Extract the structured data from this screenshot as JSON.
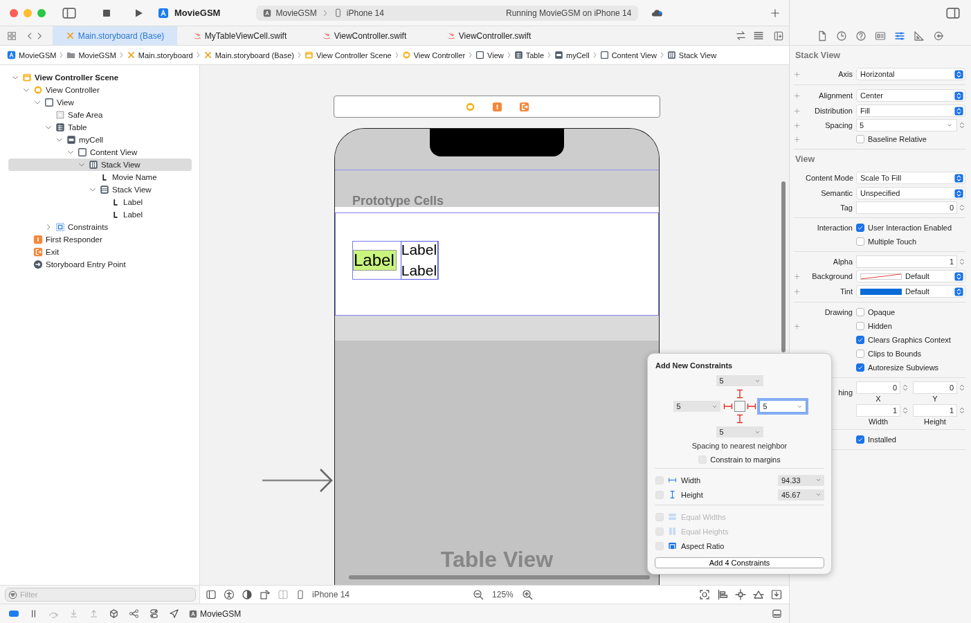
{
  "toolbar": {
    "project": "MovieGSM",
    "scheme": "MovieGSM",
    "device": "iPhone 14",
    "status": "Running MovieGSM on iPhone 14"
  },
  "tabs": [
    {
      "label": "Main.storyboard (Base)",
      "kind": "storyboard",
      "selected": true
    },
    {
      "label": "MyTableViewCell.swift",
      "kind": "swift",
      "selected": false
    },
    {
      "label": "ViewController.swift",
      "kind": "swift",
      "selected": false
    },
    {
      "label": "ViewController.swift",
      "kind": "swift",
      "selected": false
    }
  ],
  "jump_bar": [
    {
      "label": "MovieGSM",
      "kind": "app"
    },
    {
      "label": "MovieGSM",
      "kind": "folder"
    },
    {
      "label": "Main.storyboard",
      "kind": "storyboard"
    },
    {
      "label": "Main.storyboard (Base)",
      "kind": "storyboard"
    },
    {
      "label": "View Controller Scene",
      "kind": "scene"
    },
    {
      "label": "View Controller",
      "kind": "controller"
    },
    {
      "label": "View",
      "kind": "view"
    },
    {
      "label": "Table",
      "kind": "table"
    },
    {
      "label": "myCell",
      "kind": "cell"
    },
    {
      "label": "Content View",
      "kind": "view"
    },
    {
      "label": "Stack View",
      "kind": "hstack"
    }
  ],
  "navigator": {
    "tree": [
      {
        "label": "View Controller Scene",
        "kind": "scene",
        "expanded": true,
        "selected": false,
        "children": [
          {
            "label": "View Controller",
            "kind": "controller",
            "expanded": true,
            "selected": false,
            "children": [
              {
                "label": "View",
                "kind": "view",
                "expanded": true,
                "selected": false,
                "children": [
                  {
                    "label": "Safe Area",
                    "kind": "safearea",
                    "selected": false
                  },
                  {
                    "label": "Table",
                    "kind": "table",
                    "expanded": true,
                    "selected": false,
                    "children": [
                      {
                        "label": "myCell",
                        "kind": "cell",
                        "expanded": true,
                        "selected": false,
                        "children": [
                          {
                            "label": "Content View",
                            "kind": "view",
                            "expanded": true,
                            "selected": false,
                            "children": [
                              {
                                "label": "Stack View",
                                "kind": "hstack",
                                "expanded": true,
                                "selected": true,
                                "children": [
                                  {
                                    "label": "Movie Name",
                                    "kind": "label",
                                    "selected": false
                                  },
                                  {
                                    "label": "Stack View",
                                    "kind": "vstack",
                                    "expanded": true,
                                    "selected": false,
                                    "children": [
                                      {
                                        "label": "Label",
                                        "kind": "label",
                                        "selected": false
                                      },
                                      {
                                        "label": "Label",
                                        "kind": "label",
                                        "selected": false
                                      }
                                    ]
                                  }
                                ]
                              }
                            ]
                          }
                        ]
                      }
                    ]
                  },
                  {
                    "label": "Constraints",
                    "kind": "constraints",
                    "expanded": false,
                    "selected": false
                  }
                ]
              }
            ]
          },
          {
            "label": "First Responder",
            "kind": "responder",
            "selected": false
          },
          {
            "label": "Exit",
            "kind": "exit",
            "selected": false
          },
          {
            "label": "Storyboard Entry Point",
            "kind": "entry",
            "selected": false
          }
        ]
      }
    ],
    "filter": {
      "placeholder": "Filter"
    }
  },
  "canvas": {
    "header": "Prototype Cells",
    "main_label": "Label",
    "labels": [
      "Label",
      "Label"
    ],
    "title": "Table View"
  },
  "canvas_bar": {
    "device": "iPhone 14",
    "zoom": "125%"
  },
  "debug_bar": {
    "breakpoints_on": true,
    "target": "MovieGSM"
  },
  "inspector": {
    "tabs": [
      {
        "kind": "file",
        "selected": false
      },
      {
        "kind": "history",
        "selected": false
      },
      {
        "kind": "help",
        "selected": false
      },
      {
        "kind": "identity",
        "selected": false
      },
      {
        "kind": "attributes",
        "selected": true
      },
      {
        "kind": "ruler",
        "selected": false
      },
      {
        "kind": "connections",
        "selected": false
      }
    ],
    "sections": [
      {
        "title": "Stack View",
        "groups": [
          {
            "rows": [
              {
                "kind": "popup",
                "label": "Axis",
                "value": "Horizontal",
                "plus": true
              }
            ]
          },
          {
            "rows": [
              {
                "kind": "popup",
                "label": "Alignment",
                "value": "Center",
                "plus": true
              },
              {
                "kind": "popup",
                "label": "Distribution",
                "value": "Fill",
                "plus": true
              },
              {
                "kind": "combo",
                "label": "Spacing",
                "value": "5",
                "plus": true
              },
              {
                "kind": "check",
                "text": "Baseline Relative",
                "checked": false,
                "plus": true
              }
            ]
          }
        ]
      },
      {
        "title": "View",
        "groups": [
          {
            "rows": [
              {
                "kind": "popup",
                "label": "Content Mode",
                "value": "Scale To Fill",
                "plus": false
              },
              {
                "kind": "popup",
                "label": "Semantic",
                "value": "Unspecified",
                "plus": false
              },
              {
                "kind": "number",
                "label": "Tag",
                "value": "0",
                "plus": false
              }
            ]
          },
          {
            "rows": [
              {
                "kind": "check",
                "label": "Interaction",
                "text": "User Interaction Enabled",
                "checked": true,
                "plus": false
              },
              {
                "kind": "check",
                "text": "Multiple Touch",
                "checked": false,
                "plus": false
              }
            ]
          },
          {
            "rows": [
              {
                "kind": "number",
                "label": "Alpha",
                "value": "1",
                "plus": false
              },
              {
                "kind": "color",
                "label": "Background",
                "value": "Default",
                "plus": true
              },
              {
                "kind": "color",
                "label": "Tint",
                "value": "Default",
                "color": "#0a6bd8",
                "plus": true
              }
            ]
          },
          {
            "rows": [
              {
                "kind": "check",
                "label": "Drawing",
                "text": "Opaque",
                "checked": false,
                "plus": false
              },
              {
                "kind": "check",
                "text": "Hidden",
                "checked": false,
                "plus": true
              },
              {
                "kind": "check",
                "text": "Clears Graphics Context",
                "checked": true,
                "plus": false
              },
              {
                "kind": "check",
                "text": "Clips to Bounds",
                "checked": false,
                "plus": false
              },
              {
                "kind": "check",
                "text": "Autoresize Subviews",
                "checked": true,
                "plus": false
              }
            ]
          },
          {
            "rows": [
              {
                "kind": "pair",
                "label": "hing",
                "fields": [
                  {
                    "value": "0",
                    "caption": "X"
                  },
                  {
                    "value": "0",
                    "caption": "Y"
                  }
                ],
                "plus": false
              },
              {
                "kind": "pair",
                "fields": [
                  {
                    "value": "1",
                    "caption": "Width"
                  },
                  {
                    "value": "1",
                    "caption": "Height"
                  }
                ],
                "plus": false
              }
            ]
          },
          {
            "rows": [
              {
                "kind": "check",
                "text": "Installed",
                "checked": true,
                "plus": false
              }
            ]
          }
        ]
      }
    ]
  },
  "constraints_popover": {
    "title": "Add New Constraints",
    "top": {
      "value": "5",
      "on": true,
      "focused": false
    },
    "left": {
      "value": "5",
      "on": true,
      "focused": false
    },
    "right": {
      "value": "5",
      "on": true,
      "focused": true
    },
    "bottom": {
      "value": "5",
      "on": true,
      "focused": false
    },
    "note": "Spacing to nearest neighbor",
    "margins": {
      "text": "Constrain to margins",
      "checked": false
    },
    "option_groups": [
      [
        {
          "kind": "width",
          "text": "Width",
          "value": "94.33",
          "checked": false,
          "disabled": false
        },
        {
          "kind": "height",
          "text": "Height",
          "value": "45.67",
          "checked": false,
          "disabled": false
        }
      ],
      [
        {
          "kind": "equal-widths",
          "text": "Equal Widths",
          "checked": false,
          "disabled": true
        },
        {
          "kind": "equal-heights",
          "text": "Equal Heights",
          "checked": false,
          "disabled": true
        },
        {
          "kind": "aspect",
          "text": "Aspect Ratio",
          "checked": false,
          "disabled": false
        }
      ]
    ],
    "button": "Add 4 Constraints"
  }
}
